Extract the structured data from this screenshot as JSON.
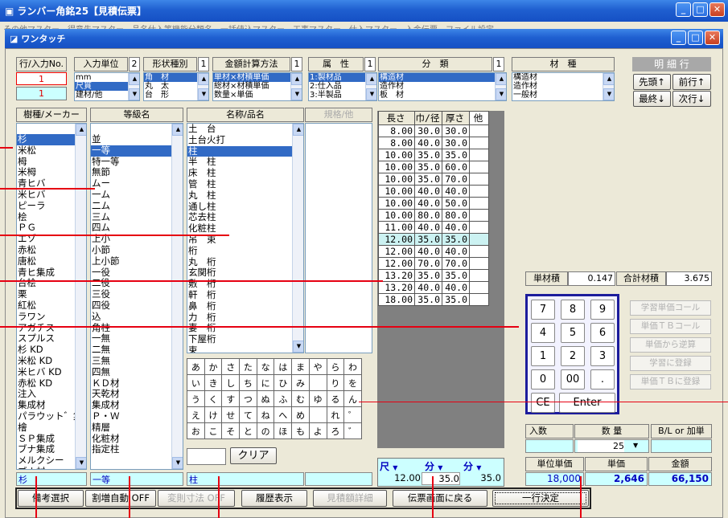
{
  "outer": {
    "title": "ランバー角銘25【見積伝票】",
    "menu": "その他マスター　得意先マスター　品名仕入等機能分類名　一括値込マスター　工事マスター　仕入マスター　入金伝票　ファイル設定"
  },
  "inner": {
    "title": "ワンタッチ"
  },
  "top": {
    "row_label": "行/入力No.",
    "row_val1": "1",
    "row_val2": "1",
    "unit_label": "入力単位",
    "unit_num": "2",
    "unit_items": [
      "mm",
      "尺貫",
      "建材/他"
    ],
    "shape_label": "形状種別",
    "shape_num": "1",
    "shape_items": [
      "角　材",
      "丸　太",
      "台　形"
    ],
    "calc_label": "金額計算方法",
    "calc_num": "1",
    "calc_items": [
      "単材×材積単価",
      "総材×材積単価",
      "数量×単価"
    ],
    "attr_label": "属　性",
    "attr_num": "1",
    "attr_items": [
      "1:製材品",
      "2:仕入品",
      "3:半製品"
    ],
    "class_label": "分　類",
    "class_num": "1",
    "class_items": [
      "構造材",
      "造作材",
      "板　材"
    ],
    "mat_label": "材　種",
    "mat_items": [
      "構造材",
      "造作材",
      "一般材"
    ]
  },
  "detail": {
    "label": "明 細 行",
    "b1": "先頭↑",
    "b2": "前行↑",
    "b3": "最終↓",
    "b4": "次行↓"
  },
  "species": {
    "header": "樹種/メーカー",
    "items": [
      "杉",
      "米松",
      "栂",
      "米栂",
      "青ヒバ",
      "米ヒバ",
      "ピーラ",
      "桧",
      "ＰＧ",
      "エゾ",
      "赤松",
      "唐松",
      "青ヒ集成",
      "台桧",
      "栗",
      "紅松",
      "ラワン",
      "アガチス",
      "スプルス",
      "杉 KD",
      "米松 KD",
      "米ヒバ KD",
      "赤松 KD",
      "注入",
      "集成材",
      "パラウット゛集成",
      "檜",
      "ＳＰ集成",
      "ブナ集成",
      "メルクシー",
      "ブナ材",
      "集成源平"
    ],
    "selected": "杉"
  },
  "grade": {
    "header": "等級名",
    "items": [
      "並",
      "一等",
      "特一等",
      "無節",
      "ムー",
      "一ム",
      "二ム",
      "三ム",
      "四ム",
      "上小",
      "小節",
      "上小節",
      "一役",
      "二役",
      "三役",
      "四役",
      "込",
      "角柱",
      "一無",
      "二無",
      "三無",
      "四無",
      "ＫＤ材",
      "天乾材",
      "集成材",
      "Ｐ・Ｗ",
      "精層",
      "化粧材",
      "指定柱"
    ],
    "selected": "一等"
  },
  "name": {
    "header": "名称/品名",
    "spec_header": "規格/他",
    "items": [
      "",
      "土　台",
      "土台火打",
      "柱",
      "半　柱",
      "床　柱",
      "管　柱",
      "丸　柱",
      "通し柱",
      "芯去柱",
      "化粧柱",
      "吊　束",
      "桁",
      "丸　桁",
      "玄関桁",
      "敷　桁",
      "軒　桁",
      "鼻　桁",
      "力　桁",
      "妻　桁",
      "下屋桁",
      "束"
    ],
    "selected": "柱"
  },
  "sizes": {
    "h_len": "長さ",
    "h_w": "巾/径",
    "h_t": "厚さ",
    "h_o": "他",
    "rows": [
      [
        "8.00",
        "30.0",
        "30.0"
      ],
      [
        "8.00",
        "40.0",
        "30.0"
      ],
      [
        "10.00",
        "35.0",
        "35.0"
      ],
      [
        "10.00",
        "35.0",
        "60.0"
      ],
      [
        "10.00",
        "35.0",
        "70.0"
      ],
      [
        "10.00",
        "40.0",
        "40.0"
      ],
      [
        "10.00",
        "40.0",
        "50.0"
      ],
      [
        "10.00",
        "80.0",
        "80.0"
      ],
      [
        "11.00",
        "40.0",
        "40.0"
      ],
      [
        "12.00",
        "35.0",
        "35.0"
      ],
      [
        "12.00",
        "40.0",
        "40.0"
      ],
      [
        "12.00",
        "70.0",
        "70.0"
      ],
      [
        "13.20",
        "35.0",
        "35.0"
      ],
      [
        "13.20",
        "40.0",
        "40.0"
      ],
      [
        "18.00",
        "35.0",
        "35.0"
      ]
    ]
  },
  "kana": [
    [
      "あ",
      "か",
      "さ",
      "た",
      "な",
      "は",
      "ま",
      "や",
      "ら",
      "わ"
    ],
    [
      "い",
      "き",
      "し",
      "ち",
      "に",
      "ひ",
      "み",
      "",
      "り",
      "を"
    ],
    [
      "う",
      "く",
      "す",
      "つ",
      "ぬ",
      "ふ",
      "む",
      "ゆ",
      "る",
      "ん"
    ],
    [
      "え",
      "け",
      "せ",
      "て",
      "ね",
      "へ",
      "め",
      "",
      "れ",
      "゜"
    ],
    [
      "お",
      "こ",
      "そ",
      "と",
      "の",
      "ほ",
      "も",
      "よ",
      "ろ",
      "゛"
    ]
  ],
  "clear": "クリア",
  "units": {
    "u1": "尺",
    "u2": "分",
    "u3": "分",
    "len": "12.00",
    "w": "35.0",
    "t": "35.0"
  },
  "vol": {
    "label1": "単材積",
    "val1": "0.147",
    "label2": "合計材積",
    "val2": "3.675"
  },
  "keypad": [
    [
      "7",
      "8",
      "9"
    ],
    [
      "4",
      "5",
      "6"
    ],
    [
      "1",
      "2",
      "3"
    ],
    [
      "0",
      "00",
      "."
    ]
  ],
  "ce": "CE",
  "enter": "Enter",
  "side": [
    "学習単価コール",
    "単価ＴＢコール",
    "単価から逆算",
    "学習に登録",
    "単価ＴＢに登録"
  ],
  "qty": {
    "l1": "入数",
    "l2": "数 量",
    "l3": "B/L or 加単",
    "qty": "25"
  },
  "price": {
    "l1": "単位単価",
    "l2": "単価",
    "l3": "金額",
    "v1": "18,000",
    "v2": "2,646",
    "v3": "66,150"
  },
  "sel": {
    "species": "杉",
    "grade": "一等",
    "name": "柱"
  },
  "footer": {
    "b1": "備考選択",
    "b2": "割増自動 OFF",
    "b3": "変則寸法 OFF",
    "b4": "履歴表示",
    "b5": "見積額詳細",
    "b6": "伝票画面に戻る",
    "b7": "一行決定"
  }
}
